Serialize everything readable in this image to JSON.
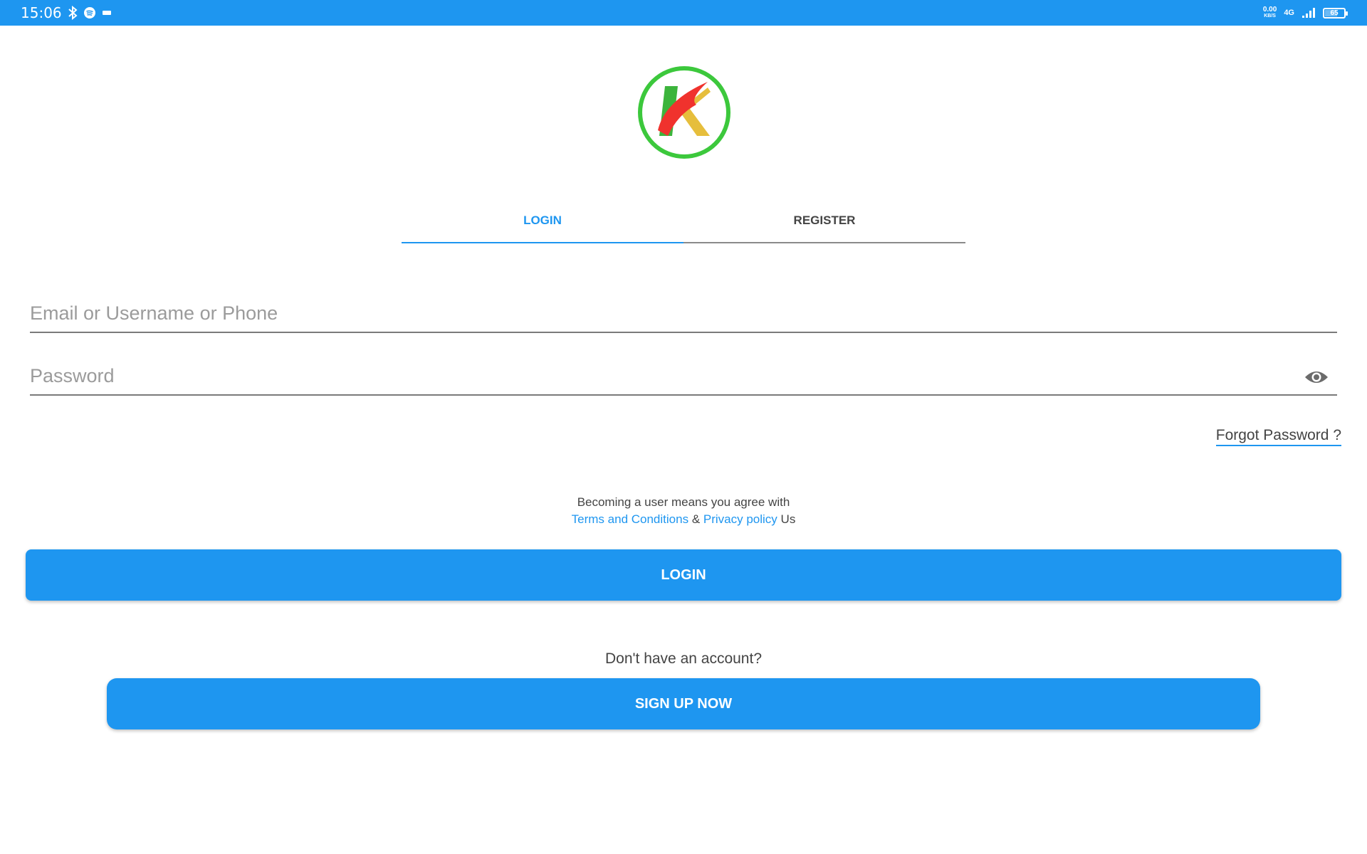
{
  "status_bar": {
    "time": "15:06",
    "icons": [
      "bluetooth-icon",
      "spotify-icon",
      "notification-icon"
    ],
    "speed_value": "0.00",
    "speed_unit": "KB/S",
    "network": "4G",
    "battery": "65"
  },
  "logo": {
    "letter": "K"
  },
  "tabs": [
    {
      "label": "LOGIN",
      "active": true
    },
    {
      "label": "REGISTER",
      "active": false
    }
  ],
  "form": {
    "email_placeholder": "Email or Username or Phone",
    "email_value": "",
    "password_placeholder": "Password",
    "password_value": "",
    "forgot_label": "Forgot Password ?"
  },
  "agreement": {
    "text": "Becoming a user means you agree with",
    "terms_link": "Terms and Conditions",
    "separator": "&",
    "privacy_link": "Privacy policy",
    "suffix": "Us"
  },
  "login_button": "LOGIN",
  "no_account_text": "Don't have an account?",
  "signup_button": "SIGN UP NOW",
  "colors": {
    "accent": "#1e96f0",
    "text": "#444444",
    "placeholder": "#9b9b9b",
    "logo_ring": "#3cc83c",
    "logo_red": "#f0322d",
    "logo_yellow": "#e6be3c",
    "logo_green": "#3cb43c"
  }
}
